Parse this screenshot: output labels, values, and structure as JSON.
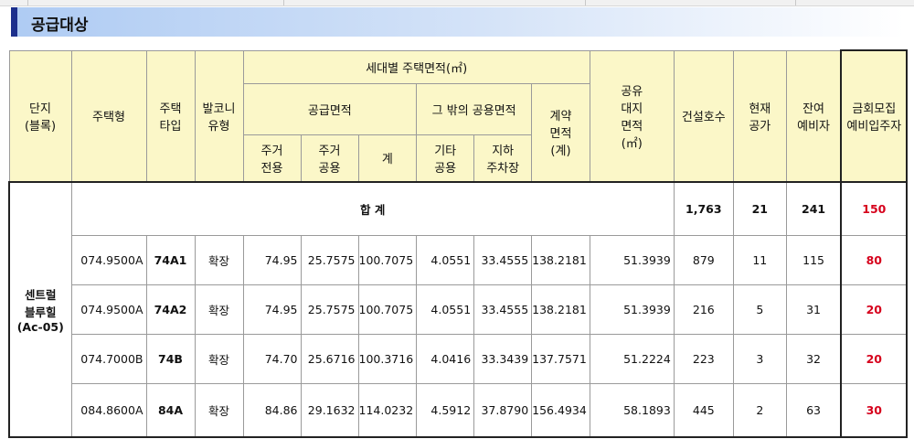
{
  "page": {
    "title": "공급대상"
  },
  "headers": {
    "complex": "단지\n(블록)",
    "housing_type": "주택형",
    "house_type": "주택\n타입",
    "balcony": "발코니\n유형",
    "area_group": "세대별 주택면적(㎡)",
    "supply_area": "공급면적",
    "other_common": "그 밖의 공용면적",
    "contract_area": "계약\n면적\n(계)",
    "res_exclusive": "주거\n전용",
    "res_common": "주거\n공용",
    "subtotal": "계",
    "other_shared": "기타\n공용",
    "parking": "지하\n주차장",
    "land": "공유\n대지\n면적\n(㎡)",
    "units": "건설호수",
    "vacant": "현재\n공가",
    "reserve": "잔여\n예비자",
    "recruit": "금회모집\n예비입주자"
  },
  "complex_name": "센트럴\n블루힐\n(Ac-05)",
  "total": {
    "label": "합        계",
    "units": "1,763",
    "vacant": "21",
    "reserve": "241",
    "recruit": "150"
  },
  "rows": [
    {
      "housing_type": "074.9500A",
      "house_type": "74A1",
      "balcony": "확장",
      "res_exclusive": "74.95",
      "res_common": "25.7575",
      "subtotal": "100.7075",
      "other_shared": "4.0551",
      "parking": "33.4555",
      "contract": "138.2181",
      "land": "51.3939",
      "units": "879",
      "vacant": "11",
      "reserve": "115",
      "recruit": "80"
    },
    {
      "housing_type": "074.9500A",
      "house_type": "74A2",
      "balcony": "확장",
      "res_exclusive": "74.95",
      "res_common": "25.7575",
      "subtotal": "100.7075",
      "other_shared": "4.0551",
      "parking": "33.4555",
      "contract": "138.2181",
      "land": "51.3939",
      "units": "216",
      "vacant": "5",
      "reserve": "31",
      "recruit": "20"
    },
    {
      "housing_type": "074.7000B",
      "house_type": "74B",
      "balcony": "확장",
      "res_exclusive": "74.70",
      "res_common": "25.6716",
      "subtotal": "100.3716",
      "other_shared": "4.0416",
      "parking": "33.3439",
      "contract": "137.7571",
      "land": "51.2224",
      "units": "223",
      "vacant": "3",
      "reserve": "32",
      "recruit": "20"
    },
    {
      "housing_type": "084.8600A",
      "house_type": "84A",
      "balcony": "확장",
      "res_exclusive": "84.86",
      "res_common": "29.1632",
      "subtotal": "114.0232",
      "other_shared": "4.5912",
      "parking": "37.8790",
      "contract": "156.4934",
      "land": "58.1893",
      "units": "445",
      "vacant": "2",
      "reserve": "63",
      "recruit": "30"
    }
  ],
  "colors": {
    "header_bg": "#fbf7c8",
    "title_accent": "#1c2f8c",
    "highlight_red": "#d6001c"
  }
}
